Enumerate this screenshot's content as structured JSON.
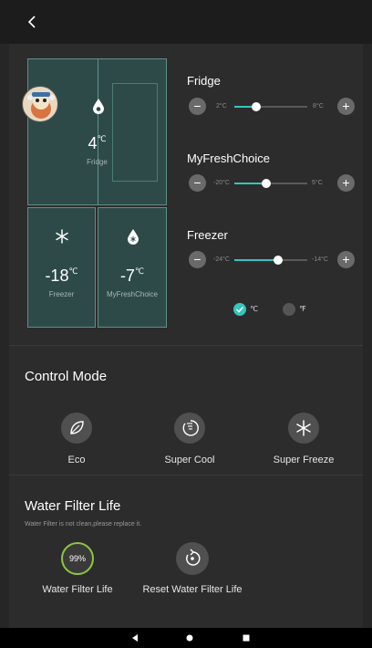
{
  "nav": {
    "back_icon": "chevron-left-icon"
  },
  "zones": {
    "fridge": {
      "temp": "4",
      "unit": "℃",
      "label": "Fridge",
      "icon": "droplet-icon"
    },
    "freezer": {
      "temp": "-18",
      "unit": "℃",
      "label": "Freezer",
      "icon": "snowflake-icon"
    },
    "myfresh": {
      "temp": "-7",
      "unit": "℃",
      "label": "MyFreshChoice",
      "icon": "droplet-snowflake-icon"
    }
  },
  "settings": {
    "fridge": {
      "title": "Fridge",
      "min": "2°C",
      "max": "8°C",
      "level": 0.3
    },
    "myfresh": {
      "title": "MyFreshChoice",
      "min": "-20°C",
      "max": "5°C",
      "level": 0.44
    },
    "freezer": {
      "title": "Freezer",
      "min": "-24°C",
      "max": "-14°C",
      "level": 0.6
    },
    "minus": "−",
    "plus": "+"
  },
  "units": {
    "celsius": "℃",
    "fahrenheit": "℉",
    "selected": "celsius"
  },
  "control": {
    "title": "Control Mode",
    "modes": [
      {
        "label": "Eco",
        "icon": "leaf-icon"
      },
      {
        "label": "Super Cool",
        "icon": "super-cool-icon"
      },
      {
        "label": "Super Freeze",
        "icon": "snowflake-icon"
      }
    ]
  },
  "water_filter": {
    "title": "Water Filter Life",
    "subtitle": "Water Filter is not clean,please replace it.",
    "percent": "99%",
    "life_label": "Water Filter Life",
    "reset_label": "Reset Water Filter Life"
  },
  "colors": {
    "accent": "#37c4bf",
    "ring": "#8dc63f",
    "zone_bg": "#2d4a49"
  }
}
